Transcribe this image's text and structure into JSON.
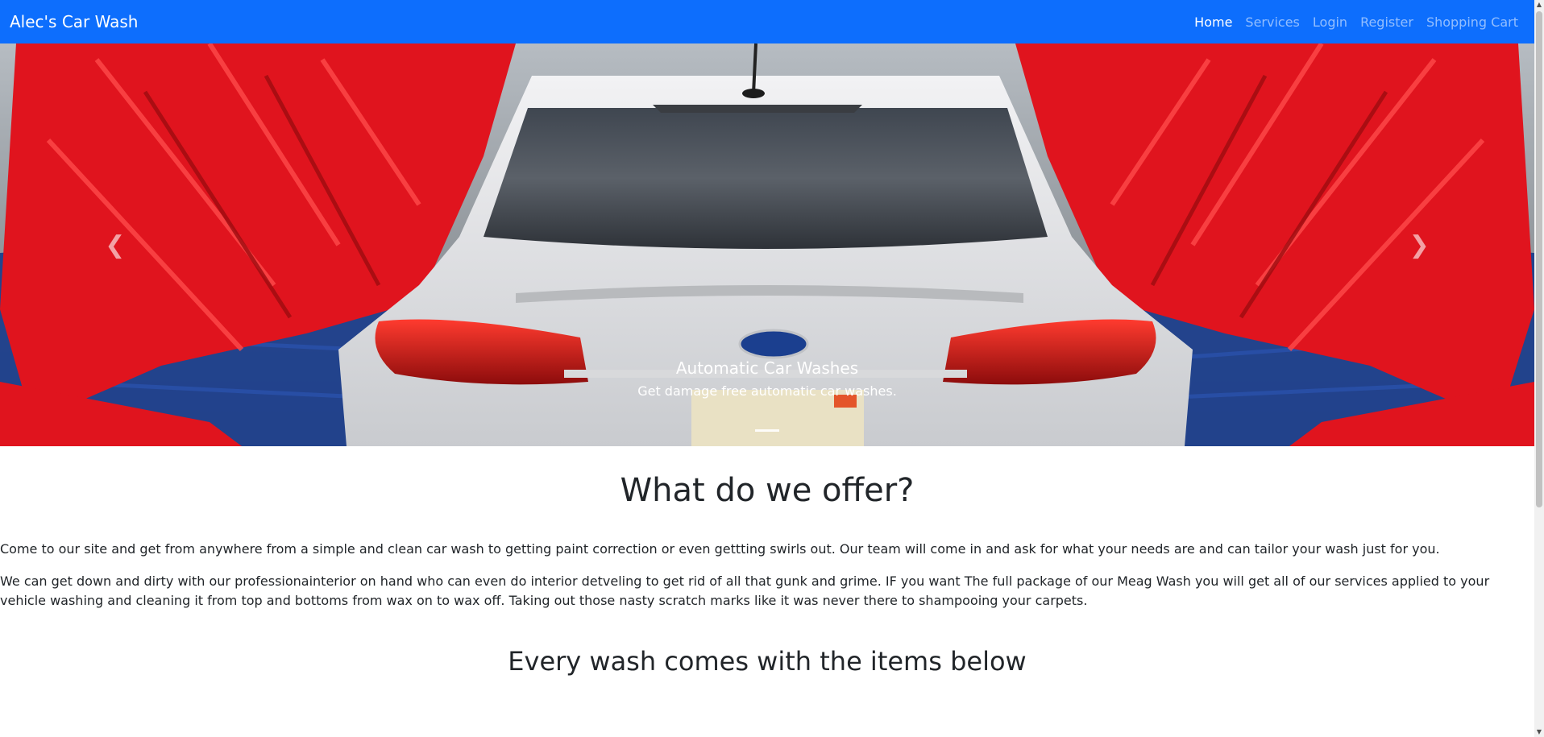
{
  "nav": {
    "brand": "Alec's Car Wash",
    "links": [
      "Home",
      "Services",
      "Login",
      "Register",
      "Shopping Cart"
    ],
    "active": "Home"
  },
  "carousel": {
    "caption_title": "Automatic Car Washes",
    "caption_text": "Get damage free automatic car washes.",
    "prev_icon": "chevron-left-icon",
    "next_icon": "chevron-right-icon"
  },
  "main": {
    "heading": "What do we offer?",
    "paragraph1": "Come to our site and get from anywhere from a simple and clean car wash to getting paint correction or even gettting swirls out. Our team will come in and ask for what your needs are and can tailor your wash just for you.",
    "paragraph2": "We can get down and dirty with our professionainterior on hand who can even do interior detveling to get rid of all that gunk and grime. IF you want The full package of our Meag Wash you will get all of our services applied to your vehicle washing and cleaning it from top and bottoms from wax on to wax off. Taking out those nasty scratch marks like it was never there to shampooing your carpets.",
    "subheading": "Every wash comes with the items below"
  },
  "colors": {
    "navbar": "#0d6efd",
    "brush_red": "#e0141e",
    "brush_blue": "#1d3f8c",
    "car": "#e6e6e8"
  }
}
